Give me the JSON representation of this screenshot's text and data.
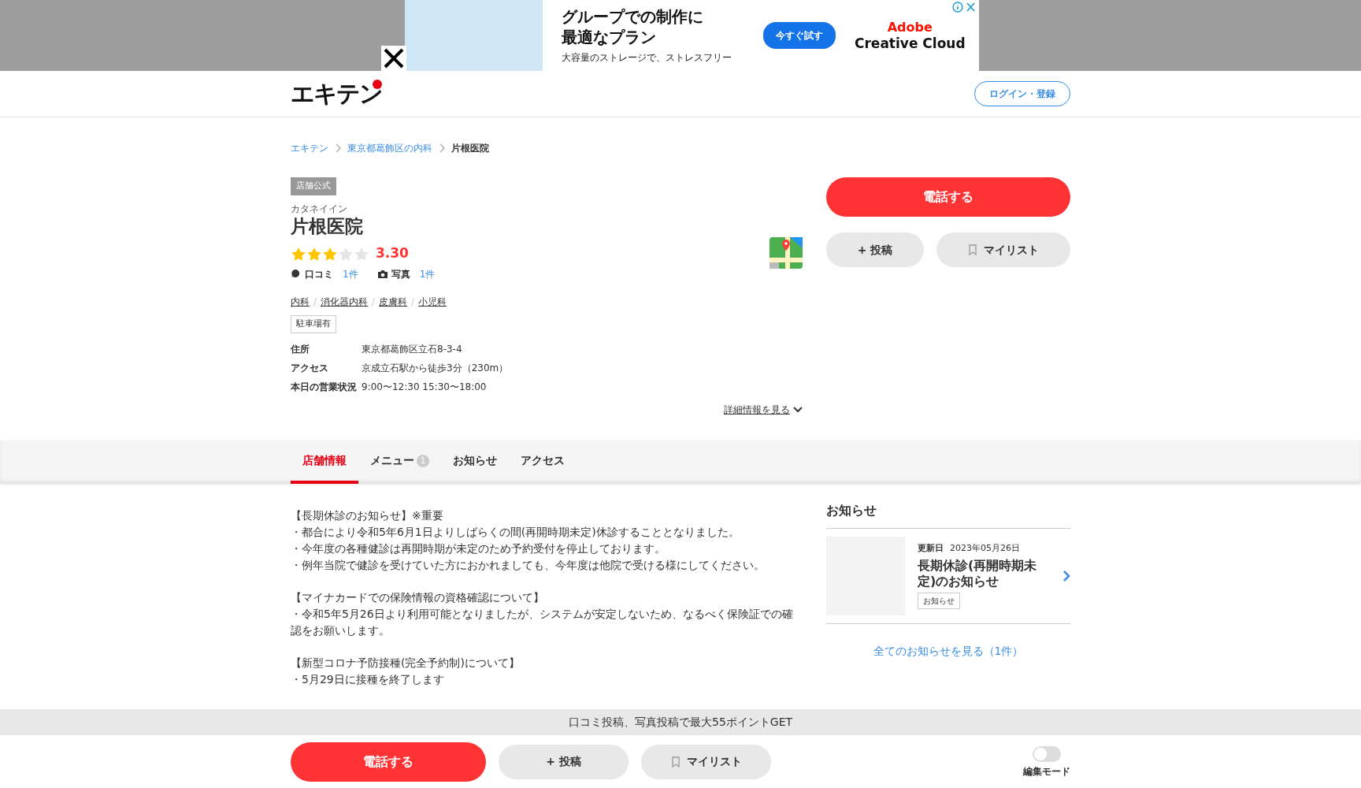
{
  "ad": {
    "headline": [
      "グループでの制作に",
      "最適なプラン"
    ],
    "subtext": "大容量のストレージで、ストレスフリー",
    "button": "今すぐ試す",
    "brand": [
      "Adobe",
      "Creative Cloud"
    ]
  },
  "header": {
    "logo": "エキテン",
    "login": "ログイン・登録"
  },
  "breadcrumb": [
    {
      "label": "エキテン",
      "current": false
    },
    {
      "label": "東京都葛飾区の内科",
      "current": false
    },
    {
      "label": "片根医院",
      "current": true
    }
  ],
  "shop": {
    "badge": "店舗公式",
    "kana": "カタネイイン",
    "name": "片根医院",
    "rating": {
      "stars": 3,
      "score": "3.30"
    },
    "counts": [
      {
        "kind": "review",
        "label": "口コミ",
        "count": "1件"
      },
      {
        "kind": "photo",
        "label": "写真",
        "count": "1件"
      }
    ],
    "categories": [
      "内科",
      "消化器内科",
      "皮膚科",
      "小児科"
    ],
    "category_separator": "/",
    "tags": [
      "駐車場有"
    ],
    "details": [
      {
        "label": "住所",
        "value": "東京都葛飾区立石8-3-4"
      },
      {
        "label": "アクセス",
        "value": "京成立石駅から徒歩3分（230m）"
      },
      {
        "label": "本日の営業状況",
        "value": "9:00〜12:30 15:30〜18:00"
      }
    ],
    "more_link": "詳細情報を見る"
  },
  "actions": {
    "call": "電話する",
    "post_icon": "+",
    "post": "投稿",
    "mylist": "マイリスト"
  },
  "tabs": [
    {
      "label": "店舗情報",
      "selected": true
    },
    {
      "label": "メニュー",
      "selected": false,
      "badge": "1"
    },
    {
      "label": "お知らせ",
      "selected": false
    },
    {
      "label": "アクセス",
      "selected": false
    }
  ],
  "body_text": [
    [
      "【長期休診のお知らせ】※重要",
      "・都合により令和5年6月1日よりしばらくの間(再開時期未定)休診することとなりました。",
      "・今年度の各種健診は再開時期が未定のため予約受付を停止しております。",
      "・例年当院で健診を受けていた方におかれましても、今年度は他院で受ける様にしてください。"
    ],
    [
      "【マイナカードでの保険情報の資格確認について】",
      "・令和5年5月26日より利用可能となりましたが、システムが安定しないため、なるべく保険証での確認をお願いします。"
    ],
    [
      "【新型コロナ予防接種(完全予約制)について】",
      "・5月29日に接種を終了します"
    ]
  ],
  "notices": {
    "title": "お知らせ",
    "items": [
      {
        "date_label": "更新日",
        "date": "2023年05月26日",
        "title": "長期休診(再開時期未定)のお知らせ",
        "tag": "お知らせ"
      }
    ],
    "all_link": "全てのお知らせを見る（1件）"
  },
  "bottom": {
    "promo": "口コミ投稿、写真投稿で最大55ポイントGET",
    "call": "電話する",
    "post_icon": "+",
    "post": "投稿",
    "mylist": "マイリスト",
    "edit_mode": {
      "label": "編集モード",
      "on": false
    }
  }
}
